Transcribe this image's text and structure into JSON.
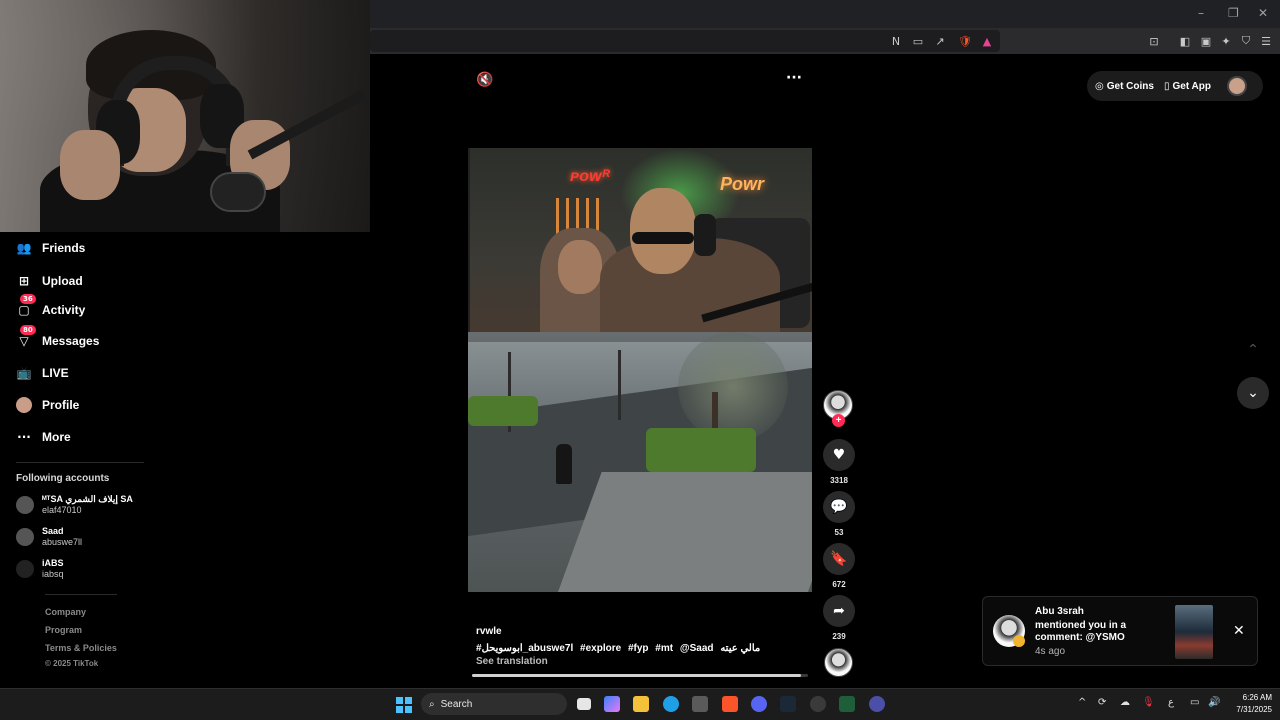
{
  "browser": {
    "window_controls": [
      "–",
      "❐",
      "✕"
    ]
  },
  "sidebar": {
    "items": [
      {
        "label": "Friends",
        "icon": "friends-icon",
        "badge": ""
      },
      {
        "label": "Upload",
        "icon": "upload-icon",
        "badge": ""
      },
      {
        "label": "Activity",
        "icon": "activity-icon",
        "badge": "36"
      },
      {
        "label": "Messages",
        "icon": "messages-icon",
        "badge": "80"
      },
      {
        "label": "LIVE",
        "icon": "live-icon",
        "badge": ""
      },
      {
        "label": "Profile",
        "icon": "profile-avatar",
        "badge": ""
      },
      {
        "label": "More",
        "icon": "more-icon",
        "badge": ""
      }
    ],
    "following_title": "Following accounts",
    "accounts": [
      {
        "name": "ᴹᵀSA إيلاف الشمري SA",
        "handle": "elaf47010"
      },
      {
        "name": "Saad",
        "handle": "abuswe7ll"
      },
      {
        "name": "iABS",
        "handle": "iabsq"
      }
    ],
    "footer": [
      "Company",
      "Program",
      "Terms & Policies",
      "© 2025 TikTok"
    ]
  },
  "video": {
    "neon_left": "ᴘᴏᴡᴿ",
    "neon_right": "Powr",
    "username": "rvwle",
    "tags": [
      "#ابوسويحل_abuswe7l",
      "#explore",
      "#fyp",
      "#mt",
      "@Saad",
      "مالي عيته"
    ],
    "see_translation": "See translation",
    "progress": 0.98
  },
  "actions": {
    "likes": "3318",
    "comments": "53",
    "saves": "672",
    "shares": "239"
  },
  "header": {
    "get_coins": "Get Coins",
    "get_app": "Get App"
  },
  "notification": {
    "title": "Abu 3srah",
    "text": "mentioned you in a comment: @YSMO",
    "time": "4s ago"
  },
  "taskbar": {
    "search_label": "Search",
    "time": "6:26 AM",
    "date": "7/31/2025",
    "tray_lang": "ع"
  },
  "colors": {
    "accent": "#fe2c55",
    "background": "#000000"
  }
}
